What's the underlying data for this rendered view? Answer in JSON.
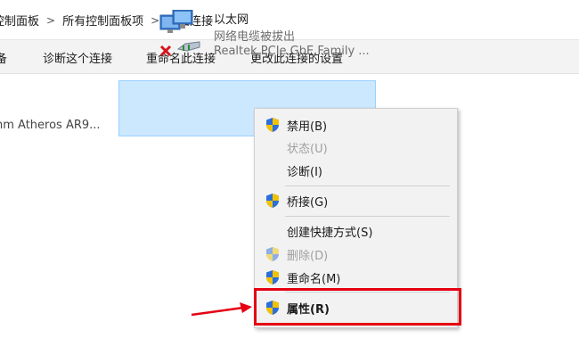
{
  "breadcrumb": {
    "items": [
      "控制面板",
      "所有控制面板项",
      "网络连接"
    ],
    "separator": ">"
  },
  "toolbar": {
    "items": [
      "备",
      "诊断这个连接",
      "重命名此连接",
      "更改此连接的设置"
    ]
  },
  "connections": {
    "wifi_label": "nm Atheros AR9...",
    "ethernet": {
      "name": "以太网",
      "status": "网络电缆被拔出",
      "adapter": "Realtek PCIe GbE Family ...",
      "icon": "network-disconnected-icon"
    }
  },
  "context_menu": {
    "items": [
      {
        "label": "禁用(B)",
        "shield": true,
        "disabled": false,
        "bold": false
      },
      {
        "label": "状态(U)",
        "shield": false,
        "disabled": true,
        "bold": false
      },
      {
        "label": "诊断(I)",
        "shield": false,
        "disabled": false,
        "bold": false
      },
      {
        "label": "桥接(G)",
        "shield": true,
        "disabled": false,
        "bold": false
      },
      {
        "label": "创建快捷方式(S)",
        "shield": false,
        "disabled": false,
        "bold": false
      },
      {
        "label": "删除(D)",
        "shield": true,
        "disabled": true,
        "bold": false
      },
      {
        "label": "重命名(M)",
        "shield": true,
        "disabled": false,
        "bold": false
      },
      {
        "label": "属性(R)",
        "shield": true,
        "disabled": false,
        "bold": true
      }
    ]
  },
  "colors": {
    "selection_bg": "#cce8ff",
    "highlight": "#e60012",
    "shield_blue": "#2a6fdb",
    "shield_yellow": "#f2c200"
  }
}
